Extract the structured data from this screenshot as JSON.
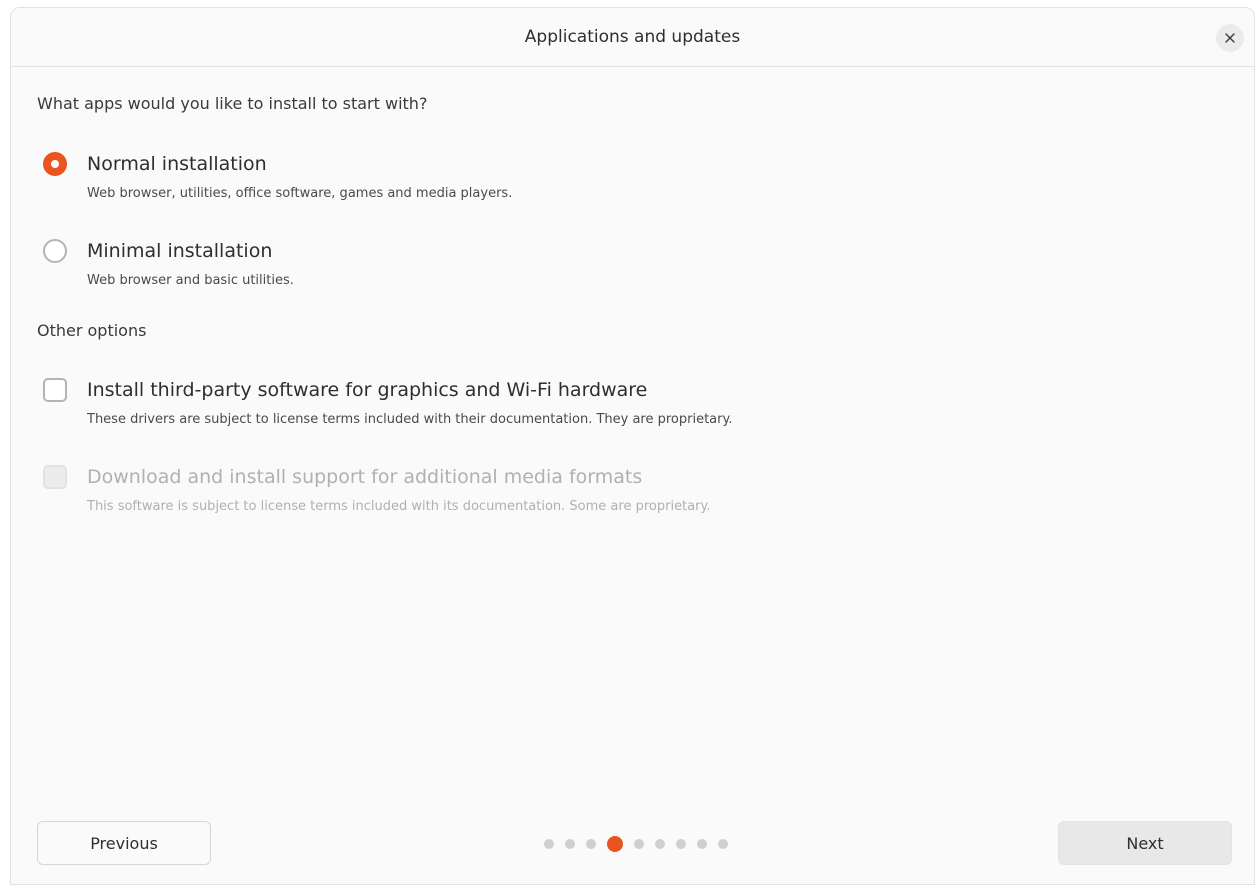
{
  "window": {
    "title": "Applications and updates"
  },
  "colors": {
    "accent": "#e95420",
    "disabled": "#b0b0b0"
  },
  "question": "What apps would you like to install to start with?",
  "install_type": {
    "selected": "normal",
    "options": [
      {
        "id": "normal",
        "label": "Normal installation",
        "description": "Web browser, utilities, office software, games and media players.",
        "checked": true
      },
      {
        "id": "minimal",
        "label": "Minimal installation",
        "description": "Web browser and basic utilities.",
        "checked": false
      }
    ]
  },
  "other_options": {
    "title": "Other options",
    "items": [
      {
        "id": "third-party",
        "label": "Install third-party software for graphics and Wi-Fi hardware",
        "description": "These drivers are subject to license terms included with their documentation. They are proprietary.",
        "checked": false,
        "enabled": true
      },
      {
        "id": "media-formats",
        "label": "Download and install support for additional media formats",
        "description": "This software is subject to license terms included with its documentation. Some are proprietary.",
        "checked": false,
        "enabled": false
      }
    ]
  },
  "footer": {
    "previous_label": "Previous",
    "next_label": "Next",
    "pagination": {
      "total": 9,
      "current": 4
    }
  },
  "icons": {
    "close": "close-icon"
  }
}
